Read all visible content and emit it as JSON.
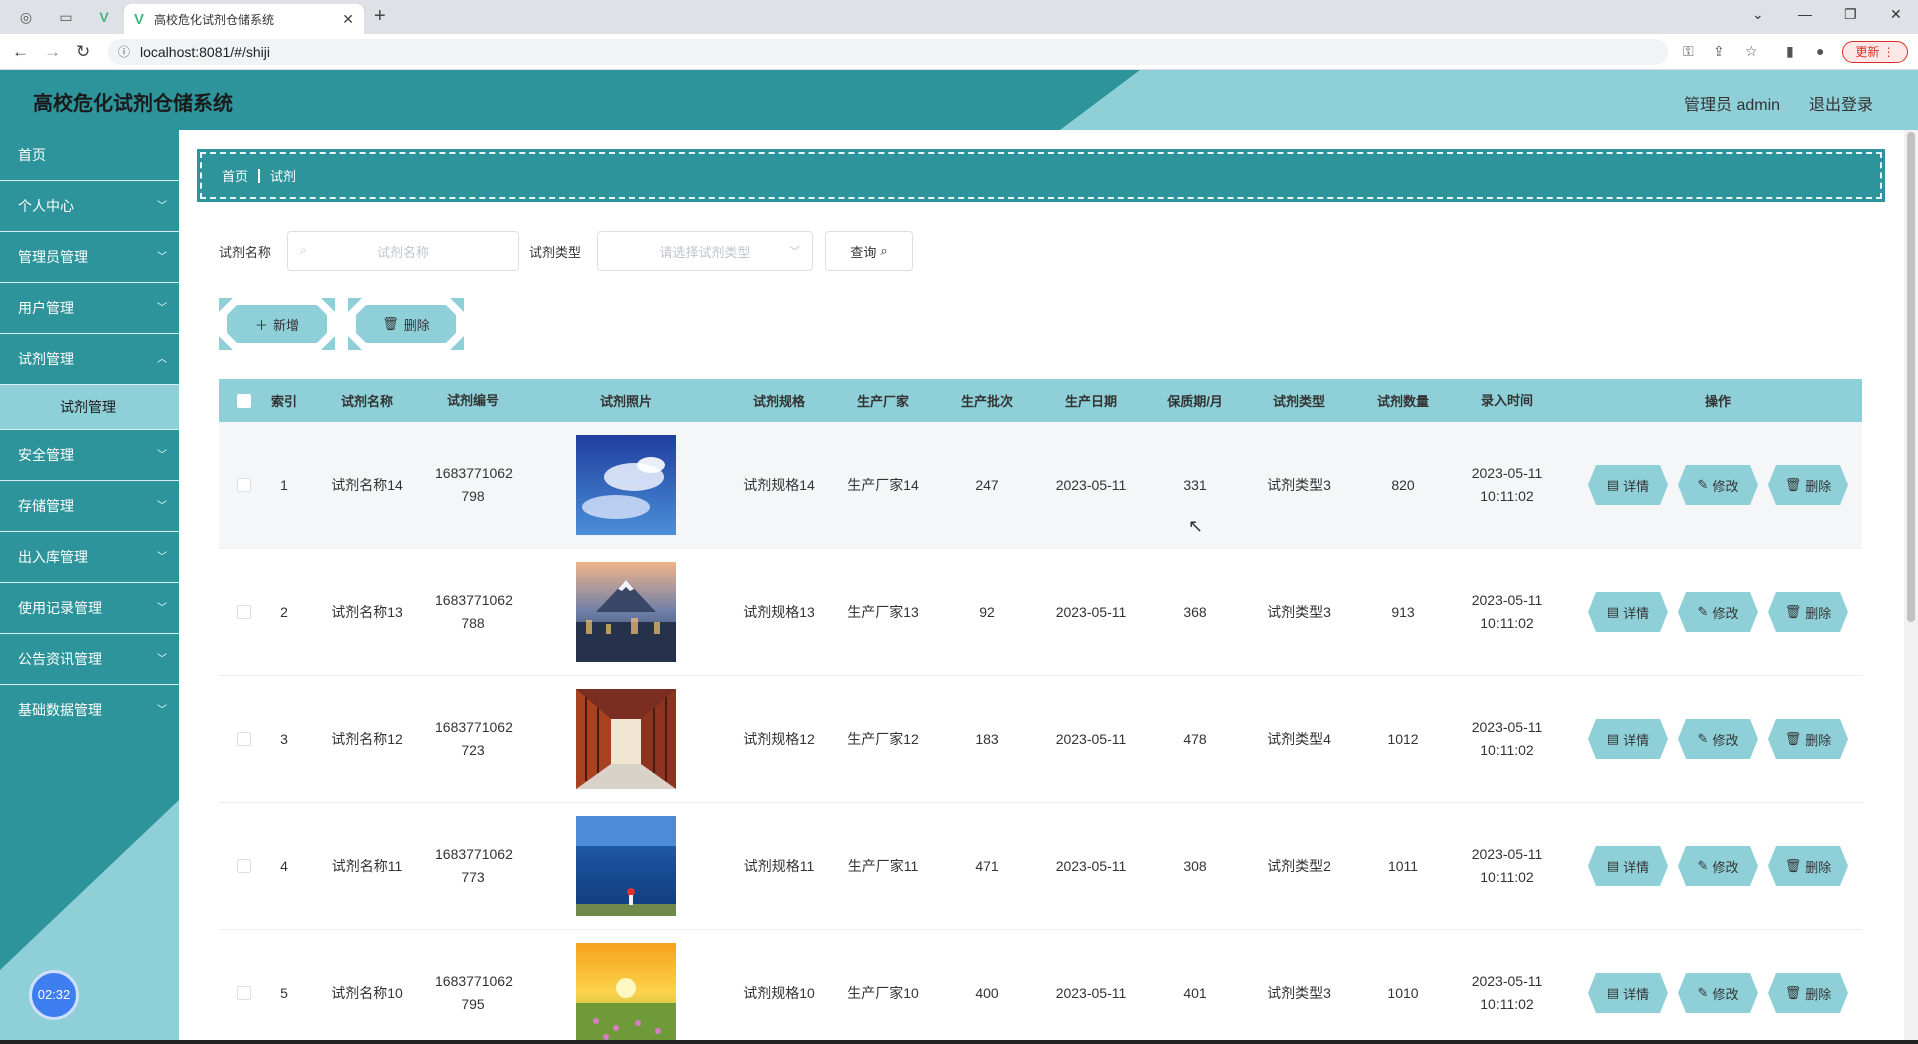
{
  "browser": {
    "tab_title": "高校危化试剂仓储系统",
    "url": "localhost:8081/#/shiji",
    "update_label": "更新"
  },
  "header": {
    "title": "高校危化试剂仓储系统",
    "user_label": "管理员 admin",
    "logout_label": "退出登录"
  },
  "sidebar": {
    "items": [
      {
        "label": "首页"
      },
      {
        "label": "个人中心"
      },
      {
        "label": "管理员管理"
      },
      {
        "label": "用户管理"
      },
      {
        "label": "试剂管理"
      },
      {
        "label": "安全管理"
      },
      {
        "label": "存储管理"
      },
      {
        "label": "出入库管理"
      },
      {
        "label": "使用记录管理"
      },
      {
        "label": "公告资讯管理"
      },
      {
        "label": "基础数据管理"
      }
    ],
    "submenu_active": "试剂管理",
    "clock": "02:32"
  },
  "breadcrumb": {
    "home": "首页",
    "current": "试剂"
  },
  "search": {
    "name_label": "试剂名称",
    "name_placeholder": "试剂名称",
    "type_label": "试剂类型",
    "type_placeholder": "请选择试剂类型",
    "query_label": "查询"
  },
  "actions": {
    "add_label": "新增",
    "delete_label": "删除"
  },
  "table": {
    "headers": {
      "index": "索引",
      "name": "试剂名称",
      "code": "试剂编号",
      "photo": "试剂照片",
      "spec": "试剂规格",
      "mfr": "生产厂家",
      "batch": "生产批次",
      "date": "生产日期",
      "shelf": "保质期/月",
      "type": "试剂类型",
      "qty": "试剂数量",
      "time": "录入时间",
      "ops": "操作"
    },
    "op_labels": {
      "detail": "详情",
      "edit": "修改",
      "delete": "删除"
    },
    "rows": [
      {
        "index": "1",
        "name": "试剂名称14",
        "code1": "1683771062",
        "code2": "798",
        "spec": "试剂规格14",
        "mfr": "生产厂家14",
        "batch": "247",
        "date": "2023-05-11",
        "shelf": "331",
        "type": "试剂类型3",
        "qty": "820",
        "time1": "2023-05-11",
        "time2": "10:11:02"
      },
      {
        "index": "2",
        "name": "试剂名称13",
        "code1": "1683771062",
        "code2": "788",
        "spec": "试剂规格13",
        "mfr": "生产厂家13",
        "batch": "92",
        "date": "2023-05-11",
        "shelf": "368",
        "type": "试剂类型3",
        "qty": "913",
        "time1": "2023-05-11",
        "time2": "10:11:02"
      },
      {
        "index": "3",
        "name": "试剂名称12",
        "code1": "1683771062",
        "code2": "723",
        "spec": "试剂规格12",
        "mfr": "生产厂家12",
        "batch": "183",
        "date": "2023-05-11",
        "shelf": "478",
        "type": "试剂类型4",
        "qty": "1012",
        "time1": "2023-05-11",
        "time2": "10:11:02"
      },
      {
        "index": "4",
        "name": "试剂名称11",
        "code1": "1683771062",
        "code2": "773",
        "spec": "试剂规格11",
        "mfr": "生产厂家11",
        "batch": "471",
        "date": "2023-05-11",
        "shelf": "308",
        "type": "试剂类型2",
        "qty": "1011",
        "time1": "2023-05-11",
        "time2": "10:11:02"
      },
      {
        "index": "5",
        "name": "试剂名称10",
        "code1": "1683771062",
        "code2": "795",
        "spec": "试剂规格10",
        "mfr": "生产厂家10",
        "batch": "400",
        "date": "2023-05-11",
        "shelf": "401",
        "type": "试剂类型3",
        "qty": "1010",
        "time1": "2023-05-11",
        "time2": "10:11:02"
      }
    ]
  },
  "colors": {
    "primary": "#2d949b",
    "accent": "#8fd0d8"
  }
}
